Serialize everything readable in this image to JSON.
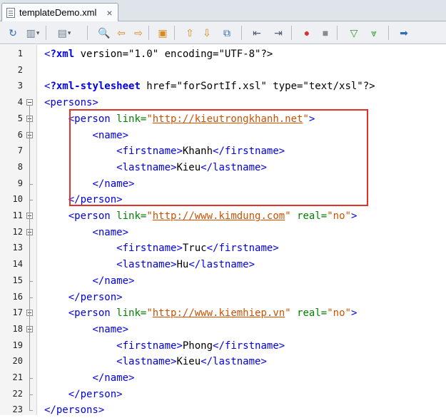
{
  "tab": {
    "filename": "templateDemo.xml",
    "close_glyph": "×"
  },
  "toolbar": {
    "buttons": [
      {
        "name": "history-icon",
        "glyph": "↻",
        "color": "#2f6db5"
      },
      {
        "name": "back-edit-icon",
        "glyph": "▥",
        "color": "#6a7a90",
        "drop": true
      },
      {
        "name": "forward-edit-icon",
        "glyph": "▤",
        "color": "#6a7a90",
        "drop": true
      },
      {
        "name": "find-icon",
        "glyph": "🔍",
        "color": "#2f6db5"
      },
      {
        "name": "find-previous-icon",
        "glyph": "⇦",
        "color": "#d98b1a"
      },
      {
        "name": "find-next-icon",
        "glyph": "⇨",
        "color": "#d98b1a"
      },
      {
        "name": "toggle-highlight-icon",
        "glyph": "▣",
        "color": "#d98b1a"
      },
      {
        "name": "previous-bookmark-icon",
        "glyph": "⇧",
        "color": "#d98b1a"
      },
      {
        "name": "next-bookmark-icon",
        "glyph": "⇩",
        "color": "#d98b1a"
      },
      {
        "name": "toggle-bookmark-icon",
        "glyph": "⧉",
        "color": "#2f6db5"
      },
      {
        "name": "shift-left-icon",
        "glyph": "⇤",
        "color": "#4a5a70"
      },
      {
        "name": "shift-right-icon",
        "glyph": "⇥",
        "color": "#4a5a70"
      },
      {
        "name": "start-macro-icon",
        "glyph": "●",
        "color": "#d9332b"
      },
      {
        "name": "stop-macro-icon",
        "glyph": "■",
        "color": "#8a8a8a"
      },
      {
        "name": "check-xml-icon",
        "glyph": "▽",
        "color": "#2e9a2e"
      },
      {
        "name": "validate-xml-icon",
        "glyph": "⩔",
        "color": "#2e9a2e"
      },
      {
        "name": "xsl-transform-icon",
        "glyph": "➡",
        "color": "#2f6db5"
      }
    ]
  },
  "lines": [
    {
      "n": "1",
      "fold": "",
      "segs": [
        [
          "t",
          "<"
        ],
        [
          "pi",
          "?xml"
        ],
        [
          "txt",
          " version=\"1.0\" encoding=\"UTF-8\"?>"
        ]
      ]
    },
    {
      "n": "2",
      "fold": "",
      "segs": []
    },
    {
      "n": "3",
      "fold": "",
      "segs": [
        [
          "t",
          "<"
        ],
        [
          "pi",
          "?xml-stylesheet"
        ],
        [
          "txt",
          " href=\"forSortIf.xsl\" type=\"text/xsl\"?>"
        ]
      ]
    },
    {
      "n": "4",
      "fold": "open",
      "segs": [
        [
          "t",
          "<persons>"
        ]
      ]
    },
    {
      "n": "5",
      "fold": "open",
      "segs": [
        [
          "txt",
          "    "
        ],
        [
          "t",
          "<person "
        ],
        [
          "a",
          "link="
        ],
        [
          "v",
          "\""
        ],
        [
          "u",
          "http://kieutrongkhanh.net"
        ],
        [
          "v",
          "\""
        ],
        [
          "t",
          ">"
        ]
      ]
    },
    {
      "n": "6",
      "fold": "open",
      "segs": [
        [
          "txt",
          "        "
        ],
        [
          "t",
          "<name>"
        ]
      ]
    },
    {
      "n": "7",
      "fold": "",
      "segs": [
        [
          "txt",
          "            "
        ],
        [
          "t",
          "<firstname>"
        ],
        [
          "txt",
          "Khanh"
        ],
        [
          "t",
          "</firstname>"
        ]
      ]
    },
    {
      "n": "8",
      "fold": "",
      "segs": [
        [
          "txt",
          "            "
        ],
        [
          "t",
          "<lastname>"
        ],
        [
          "txt",
          "Kieu"
        ],
        [
          "t",
          "</lastname>"
        ]
      ]
    },
    {
      "n": "9",
      "fold": "end",
      "segs": [
        [
          "txt",
          "        "
        ],
        [
          "t",
          "</name>"
        ]
      ]
    },
    {
      "n": "10",
      "fold": "end",
      "segs": [
        [
          "txt",
          "    "
        ],
        [
          "t",
          "</person>"
        ]
      ]
    },
    {
      "n": "11",
      "fold": "open",
      "segs": [
        [
          "txt",
          "    "
        ],
        [
          "t",
          "<person "
        ],
        [
          "a",
          "link="
        ],
        [
          "v",
          "\""
        ],
        [
          "u",
          "http://www.kimdung.com"
        ],
        [
          "v",
          "\""
        ],
        [
          "txt",
          " "
        ],
        [
          "a",
          "real="
        ],
        [
          "v",
          "\"no\""
        ],
        [
          "t",
          ">"
        ]
      ]
    },
    {
      "n": "12",
      "fold": "open",
      "segs": [
        [
          "txt",
          "        "
        ],
        [
          "t",
          "<name>"
        ]
      ]
    },
    {
      "n": "13",
      "fold": "",
      "segs": [
        [
          "txt",
          "            "
        ],
        [
          "t",
          "<firstname>"
        ],
        [
          "txt",
          "Truc"
        ],
        [
          "t",
          "</firstname>"
        ]
      ]
    },
    {
      "n": "14",
      "fold": "",
      "segs": [
        [
          "txt",
          "            "
        ],
        [
          "t",
          "<lastname>"
        ],
        [
          "txt",
          "Hu"
        ],
        [
          "t",
          "</lastname>"
        ]
      ]
    },
    {
      "n": "15",
      "fold": "end",
      "segs": [
        [
          "txt",
          "        "
        ],
        [
          "t",
          "</name>"
        ]
      ]
    },
    {
      "n": "16",
      "fold": "end",
      "segs": [
        [
          "txt",
          "    "
        ],
        [
          "t",
          "</person>"
        ]
      ]
    },
    {
      "n": "17",
      "fold": "open",
      "segs": [
        [
          "txt",
          "    "
        ],
        [
          "t",
          "<person "
        ],
        [
          "a",
          "link="
        ],
        [
          "v",
          "\""
        ],
        [
          "u",
          "http://www.kiemhiep.vn"
        ],
        [
          "v",
          "\""
        ],
        [
          "txt",
          " "
        ],
        [
          "a",
          "real="
        ],
        [
          "v",
          "\"no\""
        ],
        [
          "t",
          ">"
        ]
      ]
    },
    {
      "n": "18",
      "fold": "open",
      "segs": [
        [
          "txt",
          "        "
        ],
        [
          "t",
          "<name>"
        ]
      ]
    },
    {
      "n": "19",
      "fold": "",
      "segs": [
        [
          "txt",
          "            "
        ],
        [
          "t",
          "<firstname>"
        ],
        [
          "txt",
          "Phong"
        ],
        [
          "t",
          "</firstname>"
        ]
      ]
    },
    {
      "n": "20",
      "fold": "",
      "segs": [
        [
          "txt",
          "            "
        ],
        [
          "t",
          "<lastname>"
        ],
        [
          "txt",
          "Kieu"
        ],
        [
          "t",
          "</lastname>"
        ]
      ]
    },
    {
      "n": "21",
      "fold": "end",
      "segs": [
        [
          "txt",
          "        "
        ],
        [
          "t",
          "</name>"
        ]
      ]
    },
    {
      "n": "22",
      "fold": "end",
      "segs": [
        [
          "txt",
          "    "
        ],
        [
          "t",
          "</person>"
        ]
      ]
    },
    {
      "n": "23",
      "fold": "end",
      "segs": [
        [
          "t",
          "</persons>"
        ]
      ]
    }
  ],
  "colors": {
    "highlight_border": "#e0312b",
    "tag": "#0000e6",
    "attribute": "#008000",
    "value": "#cc5200"
  }
}
